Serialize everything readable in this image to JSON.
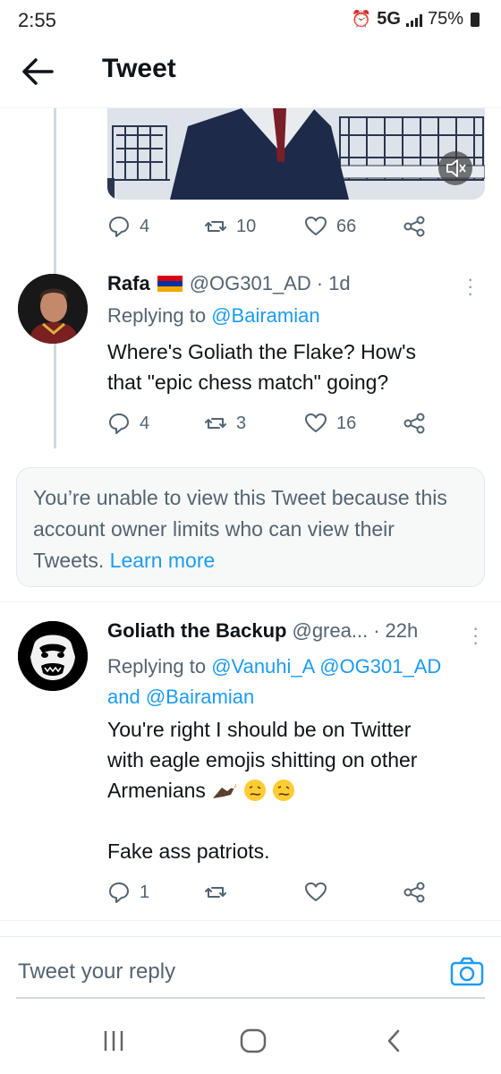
{
  "status_bar": {
    "time": "2:55",
    "network": "5G",
    "battery": "75%"
  },
  "header": {
    "title": "Tweet"
  },
  "tweet_top": {
    "replies": "4",
    "retweets": "10",
    "likes": "66"
  },
  "tweet_rafa": {
    "name": "Rafa",
    "handle": "@OG301_AD",
    "time": "1d",
    "replying_prefix": "Replying to",
    "replying_to": "@Bairamian",
    "text_line1": "Where's Goliath the Flake? How's",
    "text_line2": "that \"epic chess match\" going?",
    "replies": "4",
    "retweets": "3",
    "likes": "16"
  },
  "notice": {
    "text": "You’re unable to view this Tweet because this account owner limits who can view their Tweets.",
    "link": "Learn more"
  },
  "tweet_goliath": {
    "name": "Goliath the Backup",
    "handle": "@grea...",
    "time": "22h",
    "replying_prefix": "Replying to",
    "replying_to_1": "@Vanuhi_A",
    "replying_to_2": "@OG301_AD",
    "and_text": "and",
    "replying_to_3": "@Bairamian",
    "text_line1": "You're right I should be on Twitter",
    "text_line2": "with eagle emojis shitting on other",
    "text_line3": "Armenians",
    "text_line4": "Fake ass patriots.",
    "replies": "1"
  },
  "reply_bar": {
    "placeholder": "Tweet your reply"
  },
  "icons": {
    "accent": "#1d9bf0",
    "muted": "#536471"
  }
}
